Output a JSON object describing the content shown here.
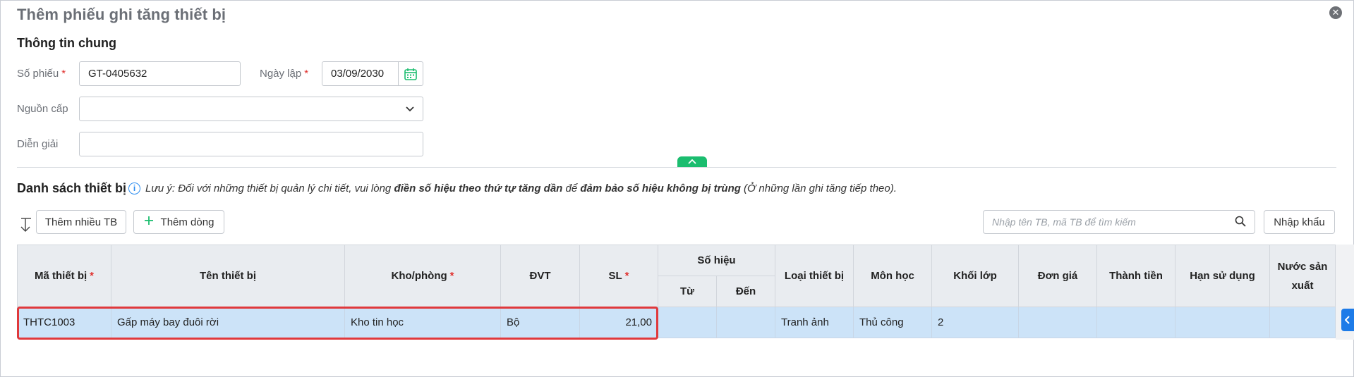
{
  "dialog": {
    "title": "Thêm phiếu ghi tăng thiết bị",
    "close_label": "✕"
  },
  "general": {
    "section_title": "Thông tin chung",
    "so_phieu_label": "Số phiếu",
    "so_phieu_value": "GT-0405632",
    "ngay_lap_label": "Ngày lập",
    "ngay_lap_value": "03/09/2030",
    "nguon_cap_label": "Nguồn cấp",
    "nguon_cap_value": "",
    "dien_giai_label": "Diễn giải",
    "dien_giai_value": "",
    "required_mark": "*"
  },
  "equipment": {
    "section_title": "Danh sách thiết bị",
    "info_symbol": "i",
    "note_prefix": "Lưu ý: Đối với những thiết bị quản lý chi tiết, vui lòng ",
    "note_bold1": "điền số hiệu theo thứ tự tăng dần",
    "note_middle": " để ",
    "note_bold2": "đảm bảo số hiệu không bị trùng",
    "note_suffix": " (Ở những lần ghi tăng tiếp theo).",
    "add_multi_label": "Thêm nhiều TB",
    "add_row_label": "Thêm dòng",
    "search_placeholder": "Nhập tên TB, mã TB để tìm kiếm",
    "import_label": "Nhập khẩu"
  },
  "table": {
    "headers": {
      "ma_thiet_bi": "Mã thiết bị",
      "ten_thiet_bi": "Tên thiết bị",
      "kho_phong": "Kho/phòng",
      "dvt": "ĐVT",
      "sl": "SL",
      "so_hieu": "Số hiệu",
      "tu": "Từ",
      "den": "Đến",
      "loai_thiet_bi": "Loại thiết bị",
      "mon_hoc": "Môn học",
      "khoi_lop": "Khối lớp",
      "don_gia": "Đơn giá",
      "thanh_tien": "Thành tiền",
      "han_su_dung": "Hạn sử dụng",
      "nuoc_san_xuat": "Nước sản xuất"
    },
    "rows": [
      {
        "ma_thiet_bi": "THTC1003",
        "ten_thiet_bi": "Gấp máy bay đuôi rời",
        "kho_phong": "Kho tin học",
        "dvt": "Bộ",
        "sl": "21,00",
        "tu": "",
        "den": "",
        "loai_thiet_bi": "Tranh ảnh",
        "mon_hoc": "Thủ công",
        "khoi_lop": "2",
        "don_gia": "",
        "thanh_tien": "",
        "han_su_dung": "",
        "nuoc_san_xuat": ""
      }
    ]
  },
  "colors": {
    "accent_green": "#1bbd6f",
    "accent_blue": "#1d7be8",
    "required_red": "#e0302d",
    "row_selected": "#cce3f8",
    "highlight_border": "#e0393c"
  }
}
